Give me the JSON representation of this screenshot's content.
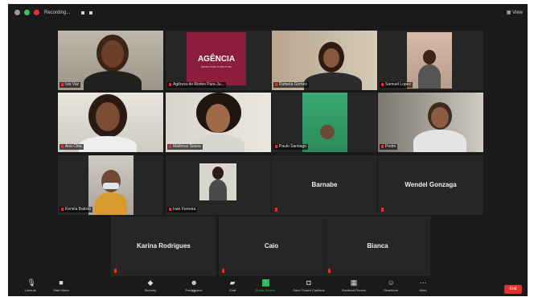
{
  "top_bar": {
    "status": "Recording...",
    "view": "View"
  },
  "tiles": {
    "t1": "Isis Vaz",
    "t2": "Agência de Redes Para Ju...",
    "t3": "Rafaela Gomes",
    "t4": "Samuel Lopez",
    "t5": "Ana Cléa",
    "t6": "Matheus Souza",
    "t7": "Paulo Santiago",
    "t8": "Pedro",
    "t9": "Kemila Batista",
    "t10": "Ivan Ferreira",
    "t11": "Barnabe",
    "t12": "Wendel Gonzaga",
    "t13": "Karina Rodrigues",
    "t14": "Caio",
    "t15": "Bianca"
  },
  "logo_text": "AGÊNCIA",
  "logo_subtext": "REDES PARA JUVENTUDE",
  "toolbar": {
    "unmute": "Unmute",
    "start_video": "Start Video",
    "security": "Security",
    "participants": "Participants",
    "participants_count": "15",
    "chat": "Chat",
    "share_screen": "Share Screen",
    "save_captions": "Save Closed Captions",
    "breakout_rooms": "Breakout Rooms",
    "reactions": "Reactions",
    "more": "More",
    "end": "End"
  },
  "colors": {
    "accent": "#b9d23a",
    "red": "#e0322f",
    "logo_bg": "#8b1e3f"
  }
}
